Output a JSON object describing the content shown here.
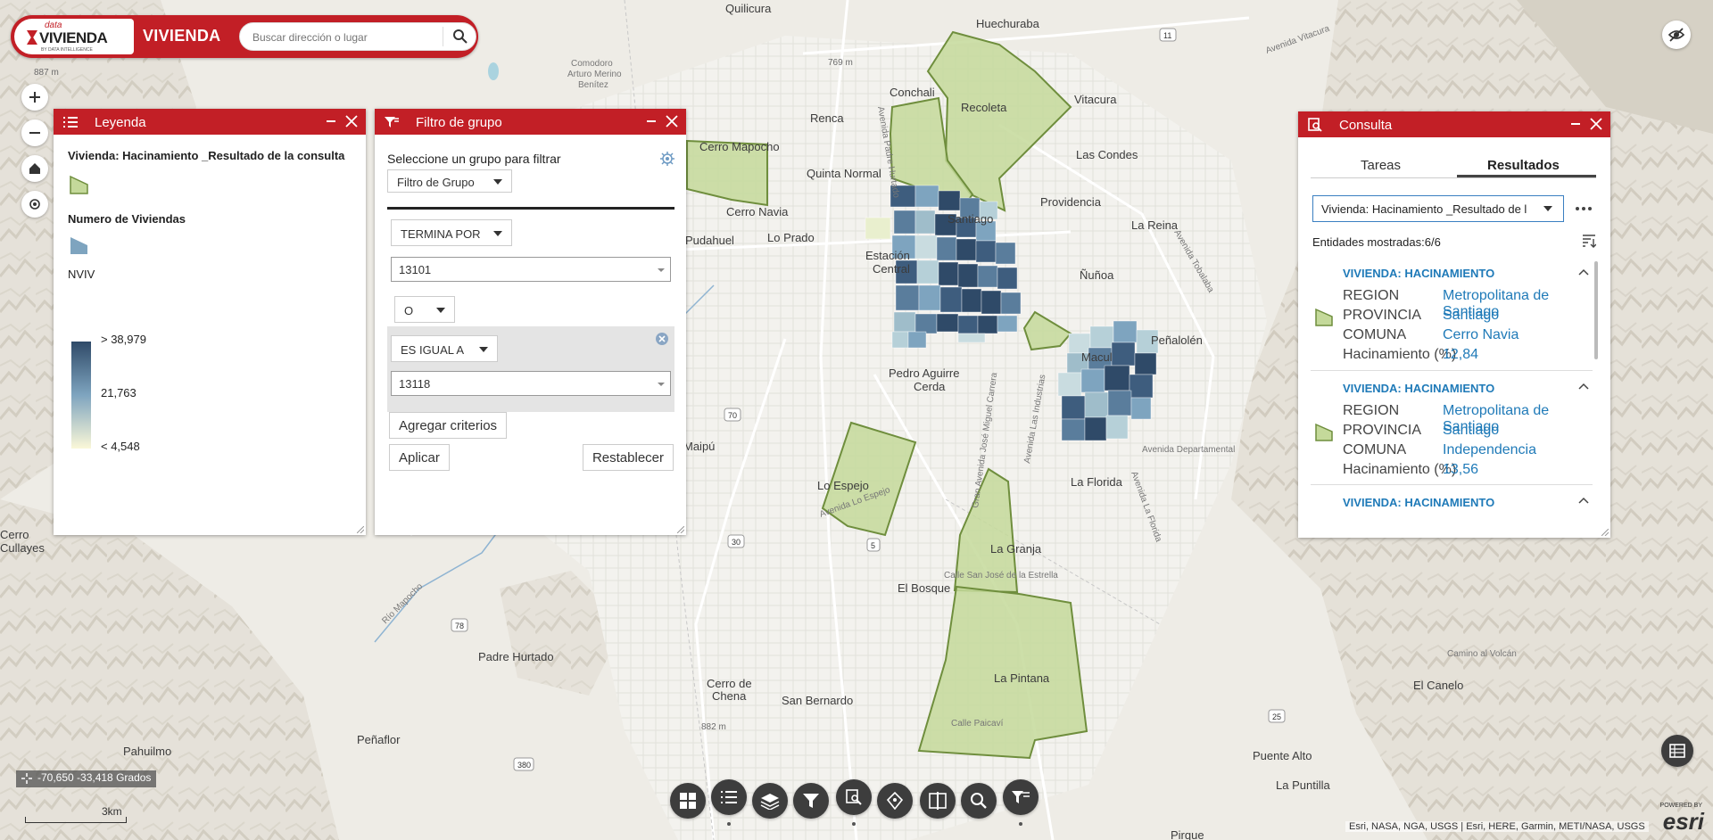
{
  "header": {
    "logo_top": "data",
    "logo_main": "VIVIENDA",
    "logo_sub": "BY DATA INTELLIGENCE",
    "app_title": "VIVIENDA",
    "search_placeholder": "Buscar dirección o lugar"
  },
  "map_labels": {
    "places": [
      "Quilicura",
      "Huechuraba",
      "Conchali",
      "Recoleta",
      "Vitacura",
      "Renca",
      "Quinta Normal",
      "Cerro Mapocho",
      "Las Condes",
      "Providencia",
      "Cerro Navia",
      "Santiago",
      "Pudahuel",
      "Lo Prado",
      "Estación Central",
      "Ñuñoa",
      "La Reina",
      "Macul",
      "Peñalolén",
      "Pedro Aguirre Cerda",
      "Maipú",
      "Lo Espejo",
      "La Florida",
      "La Granja",
      "El Bosque",
      "Padre Hurtado",
      "Cerro de Chena",
      "San Bernardo",
      "La Pintana",
      "Puente Alto",
      "Peñaflor",
      "El Canelo",
      "Pirque",
      "Cerro Cullayes",
      "La Puntilla",
      "Pahuilmo"
    ],
    "roads": [
      "Avenida Vitacura",
      "Avenida Padre Hurtado",
      "Avenida Tobalaba",
      "Gran Avenida José Miguel Carrera",
      "Avenida Las Industrias",
      "Avenida Departamental",
      "Calle San José de la Estrella",
      "Camino al Volcán",
      "Avenida La Florida",
      "Río Mapocho",
      "Avenida Lo Espejo",
      "Calle Paicaví",
      "Comodoro Arturo Merino Benítez"
    ],
    "shields": [
      "11",
      "70",
      "30",
      "78",
      "380",
      "5",
      "25"
    ],
    "elevations": [
      "887 m",
      "882 m",
      "769 m"
    ]
  },
  "legend_panel": {
    "title": "Leyenda",
    "layer_title": "Vivienda: Hacinamiento _Resultado de la consulta",
    "sublayer_title": "Numero de Viviendas",
    "field": "NVIV",
    "ramp_max": "> 38,979",
    "ramp_mid": "21,763",
    "ramp_min": "< 4,548",
    "color_low": "#fbf8d8",
    "color_high": "#2f4a68",
    "polygon_color": "#c4d99a"
  },
  "filter_panel": {
    "title": "Filtro de grupo",
    "prompt": "Seleccione un grupo para filtrar",
    "group_select": "Filtro de Grupo",
    "operator1": "TERMINA POR",
    "value1": "13101",
    "logic": "O",
    "operator2": "ES IGUAL A",
    "value2": "13118",
    "add_label": "Agregar criterios",
    "apply_label": "Aplicar",
    "reset_label": "Restablecer"
  },
  "query_panel": {
    "title": "Consulta",
    "tab_tasks": "Tareas",
    "tab_results": "Resultados",
    "selected_result": "Vivienda: Hacinamiento _Resultado de l",
    "features_shown": "Entidades mostradas:6/6",
    "results": [
      {
        "title": "VIVIENDA: HACINAMIENTO",
        "region_label": "REGION",
        "region": "Metropolitana de Santiago",
        "provincia_label": "PROVINCIA",
        "provincia": "Santiago",
        "comuna_label": "COMUNA",
        "comuna": "Cerro Navia",
        "hac_label": "Hacinamiento (%)",
        "hac": "12,84"
      },
      {
        "title": "VIVIENDA: HACINAMIENTO",
        "region_label": "REGION",
        "region": "Metropolitana de Santiago",
        "provincia_label": "PROVINCIA",
        "provincia": "Santiago",
        "comuna_label": "COMUNA",
        "comuna": "Independencia",
        "hac_label": "Hacinamiento (%)",
        "hac": "13,56"
      },
      {
        "title": "VIVIENDA: HACINAMIENTO"
      }
    ]
  },
  "map_status": {
    "coords": "-70,650 -33,418 Grados",
    "scale": "3km",
    "attribution": "Esri, NASA, NGA, USGS | Esri, HERE, Garmin, METI/NASA, USGS",
    "powered_by": "POWERED BY",
    "esri": "esri"
  },
  "toolbar": [
    "grid-icon",
    "list-icon",
    "layers-icon",
    "filter-icon",
    "query-icon",
    "map-pin-icon",
    "swipe-icon",
    "search-icon",
    "group-filter-icon"
  ]
}
